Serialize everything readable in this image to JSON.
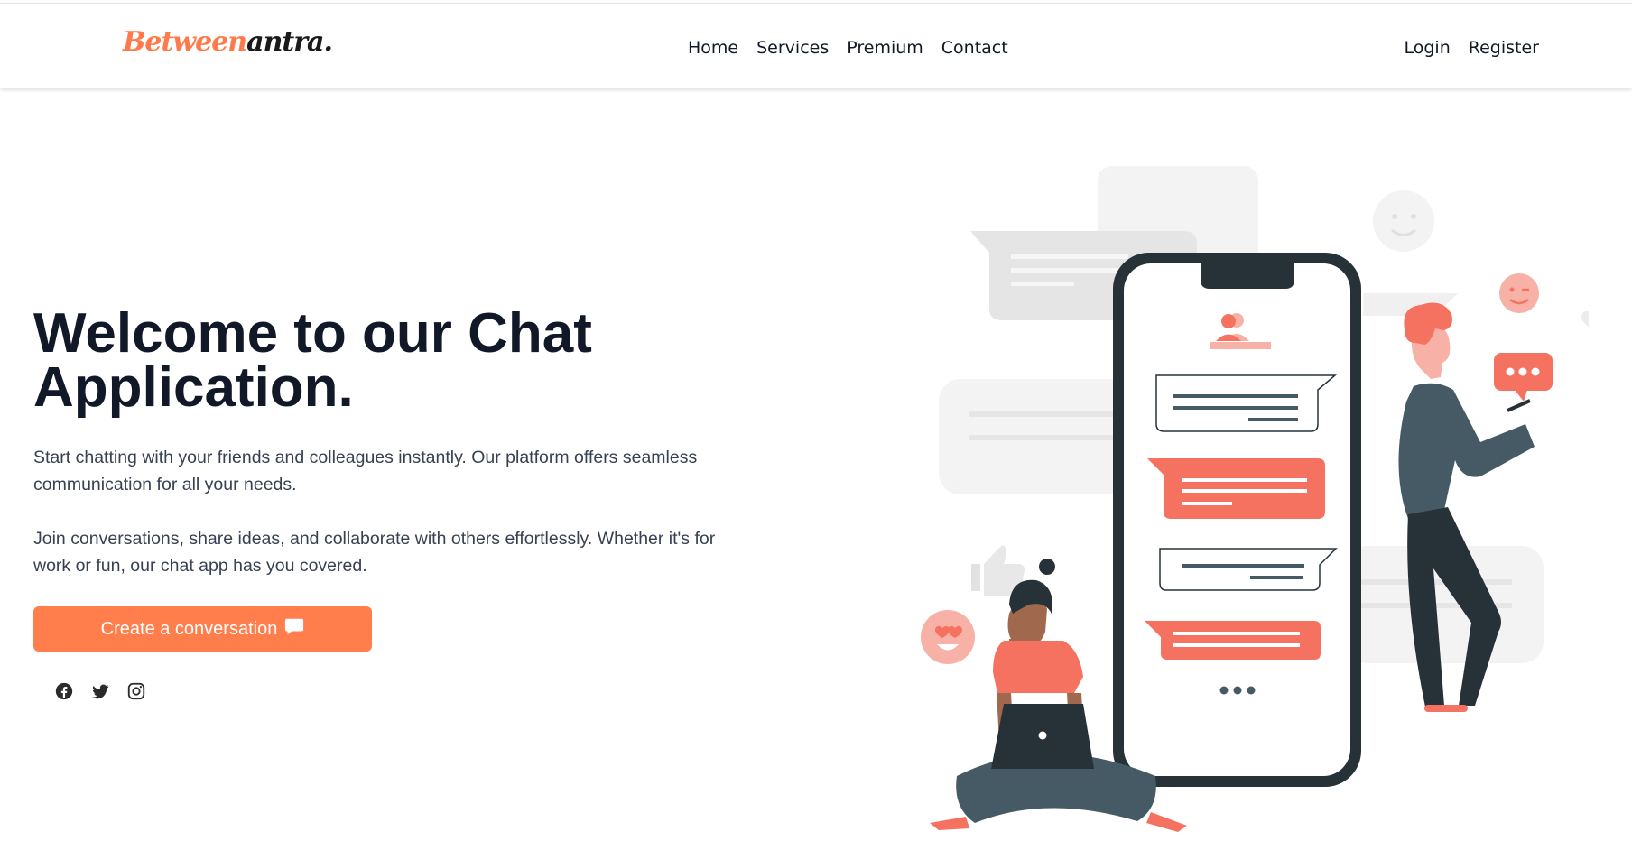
{
  "brand": {
    "logo_part1": "Between",
    "logo_part2": "antra."
  },
  "nav": {
    "center": [
      "Home",
      "Services",
      "Premium",
      "Contact"
    ],
    "right": [
      "Login",
      "Register"
    ]
  },
  "hero": {
    "title": "Welcome to our Chat Application.",
    "paragraph1": "Start chatting with your friends and colleagues instantly. Our platform offers seamless communication for all your needs.",
    "paragraph2": "Join conversations, share ideas, and collaborate with others effortlessly. Whether it's for work or fun, our chat app has you covered.",
    "cta_label": "Create a conversation"
  },
  "icons": {
    "cta": "chat-bubble-icon",
    "socials": [
      "facebook-icon",
      "twitter-icon",
      "instagram-icon"
    ]
  },
  "colors": {
    "accent": "#ff7e4b",
    "illustration_coral": "#f57260",
    "illustration_dark": "#263238",
    "text_dark": "#111827"
  }
}
